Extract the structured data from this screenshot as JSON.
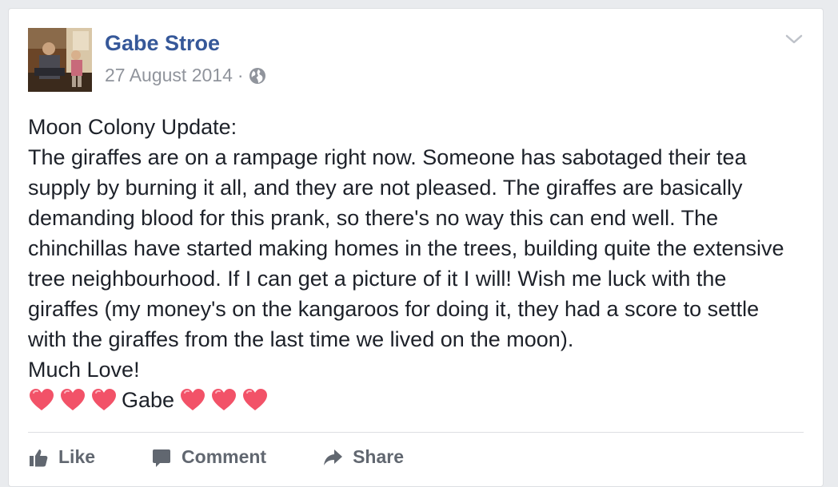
{
  "post": {
    "author": "Gabe Stroe",
    "date": "27 August 2014",
    "separator": "·",
    "privacy_icon": "globe-icon",
    "menu_icon": "chevron-down-icon",
    "lines": [
      "Moon Colony Update:",
      "The giraffes are on a rampage right now. Someone has sabotaged their tea supply by burning it all, and they are not pleased. The giraffes are basically demanding blood for this prank, so there's no way this can end well. The chinchillas have started making homes in the trees, building quite the extensive tree neighbourhood. If I can get a picture of it I will! Wish me luck with the giraffes (my money's on the kangaroos for doing it, they had a score to settle with the giraffes from the last time we lived on the moon).",
      "Much Love!"
    ],
    "signoff": "Gabe",
    "heart_color": "#f25268"
  },
  "actions": {
    "like": "Like",
    "comment": "Comment",
    "share": "Share"
  },
  "colors": {
    "author_link": "#365899",
    "meta": "#90949c",
    "text": "#1d2129"
  }
}
